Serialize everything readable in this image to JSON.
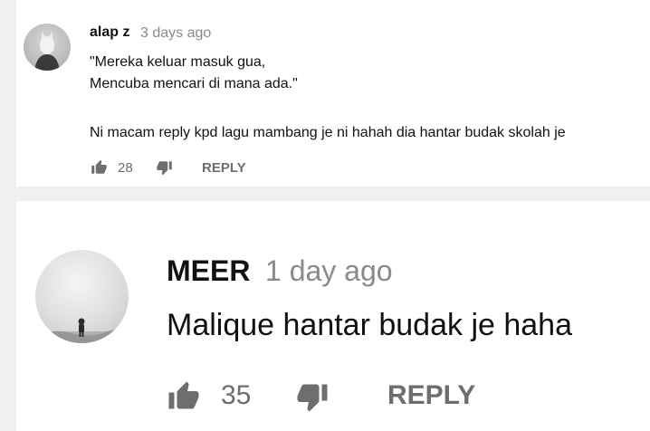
{
  "comments": [
    {
      "author": "alap z",
      "time": "3 days ago",
      "lines": [
        "\"Mereka keluar masuk gua,",
        "Mencuba mencari di mana ada.\"",
        "Ni macam reply kpd lagu mambang je ni hahah dia hantar budak skolah je"
      ],
      "likes": "28",
      "reply_label": "REPLY"
    },
    {
      "author": "MEER",
      "time": "1 day ago",
      "lines": [
        "Malique hantar budak je haha"
      ],
      "likes": "35",
      "reply_label": "REPLY"
    }
  ],
  "icons": {
    "like": "thumbs-up-icon",
    "dislike": "thumbs-down-icon"
  },
  "colors": {
    "background": "#f0f0f0",
    "card": "#ffffff",
    "text": "#111111",
    "muted": "#6e6e6e",
    "timestamp": "#8a8a8a"
  }
}
